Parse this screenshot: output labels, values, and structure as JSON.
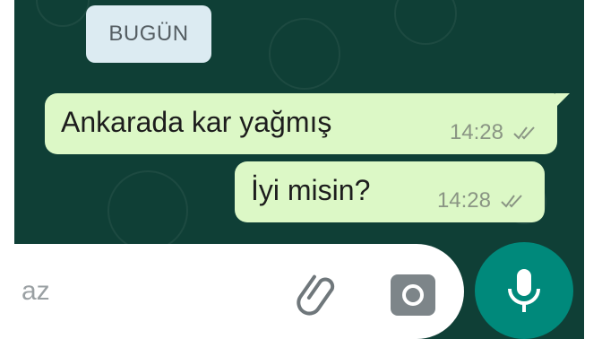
{
  "date_chip": "BUGÜN",
  "messages": [
    {
      "text": "Ankarada kar yağmış",
      "time": "14:28"
    },
    {
      "text": "İyi misin?",
      "time": "14:28"
    }
  ],
  "input": {
    "placeholder_visible": "az"
  },
  "icons": {
    "attach": "paperclip-icon",
    "camera": "camera-icon",
    "mic": "microphone-icon",
    "read_receipt": "double-check-icon"
  },
  "colors": {
    "chat_background": "#0f3f36",
    "outgoing_bubble": "#dcf8c6",
    "date_chip": "#dcebf2",
    "mic_button": "#00897b"
  }
}
